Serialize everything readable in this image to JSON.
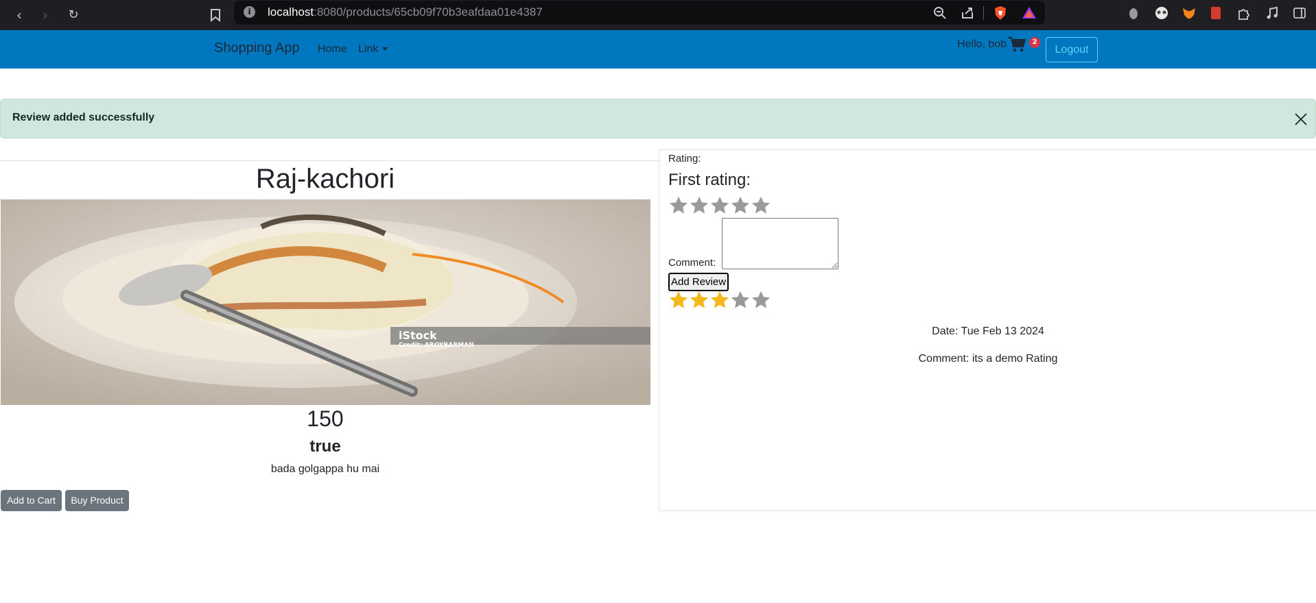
{
  "browser": {
    "url_host": "localhost",
    "url_path": ":8080/products/65cb09f70b3eafdaa01e4387"
  },
  "navbar": {
    "brand": "Shopping App",
    "home": "Home",
    "link": "Link",
    "greeting": "Hello, bob",
    "cart_count": "2",
    "logout": "Logout",
    "accent_color": "#0077be"
  },
  "alert": {
    "message": "Review added successfully"
  },
  "product": {
    "title": "Raj-kachori",
    "image_watermark": "iStock",
    "image_credit": "Credit: AROYBARMAN",
    "price": "150",
    "in_stock": "true",
    "description": "bada golgappa hu mai",
    "add_to_cart": "Add to Cart",
    "buy_product": "Buy Product"
  },
  "review_form": {
    "rating_label": "Rating:",
    "first_rating_label": "First rating:",
    "selected_stars": 0,
    "max_stars": 5,
    "comment_label": "Comment:",
    "comment_value": "",
    "submit": "Add Review"
  },
  "reviews": [
    {
      "stars": 3,
      "max_stars": 5,
      "date": "Date: Tue Feb 13 2024",
      "comment": "Comment: its a demo Rating"
    }
  ]
}
